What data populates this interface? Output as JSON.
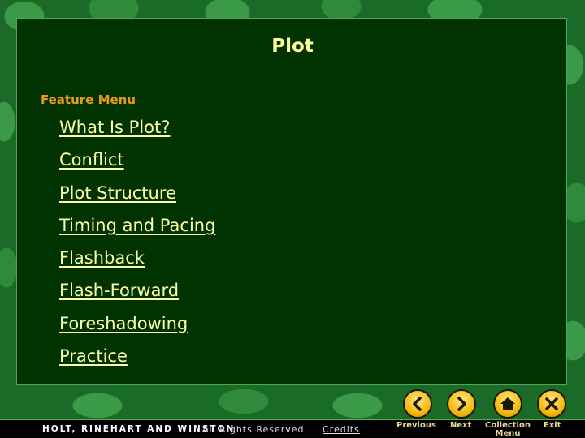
{
  "slide": {
    "title": "Plot",
    "section_label": "Feature Menu",
    "menu_items": [
      {
        "label": "What Is Plot?"
      },
      {
        "label": "Conflict"
      },
      {
        "label": "Plot Structure"
      },
      {
        "label": "Timing and Pacing"
      },
      {
        "label": "Flashback"
      },
      {
        "label": "Flash-Forward"
      },
      {
        "label": "Foreshadowing"
      },
      {
        "label": "Practice"
      }
    ]
  },
  "nav": {
    "previous": {
      "label": "Previous",
      "icon": "chevron-left-icon"
    },
    "next": {
      "label": "Next",
      "icon": "chevron-right-icon"
    },
    "collection_menu": {
      "label_line1": "Collection",
      "label_line2": "Menu",
      "icon": "home-icon"
    },
    "exit": {
      "label": "Exit",
      "icon": "close-icon"
    }
  },
  "footer": {
    "publisher": "HOLT, RINEHART AND WINSTON",
    "rights": "All Rights Reserved",
    "credits": "Credits"
  },
  "colors": {
    "panel": "#003300",
    "title": "#ffff99",
    "section_label": "#e89a1e",
    "link": "#ffffa8",
    "button": "#f7b80f"
  }
}
